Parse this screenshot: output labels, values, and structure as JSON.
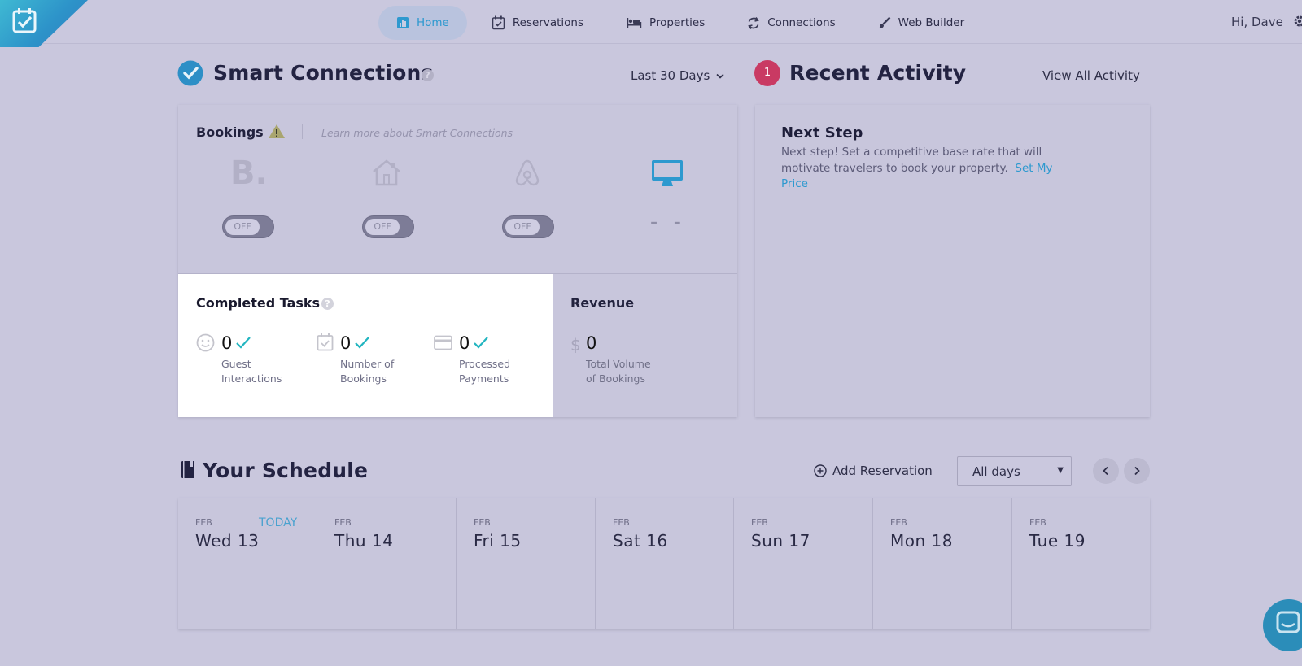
{
  "nav": {
    "items": [
      {
        "label": "Home",
        "icon": "bar-chart-icon",
        "active": true
      },
      {
        "label": "Reservations",
        "icon": "calendar-check-icon",
        "active": false
      },
      {
        "label": "Properties",
        "icon": "bed-icon",
        "active": false
      },
      {
        "label": "Connections",
        "icon": "sync-icon",
        "active": false
      },
      {
        "label": "Web Builder",
        "icon": "brush-icon",
        "active": false
      }
    ],
    "greeting": "Hi, Dave"
  },
  "smart_connections": {
    "title": "Smart Connections",
    "period": "Last 30 Days",
    "bookings": {
      "title": "Bookings",
      "learn_more": "Learn more about Smart Connections",
      "channels": [
        {
          "name": "booking-com",
          "icon": "booking-b-icon",
          "state": "OFF"
        },
        {
          "name": "homeaway",
          "icon": "house-icon",
          "state": "OFF"
        },
        {
          "name": "airbnb",
          "icon": "airbnb-icon",
          "state": "OFF"
        },
        {
          "name": "website",
          "icon": "monitor-icon",
          "state": "- -"
        }
      ]
    },
    "completed_tasks": {
      "title": "Completed Tasks",
      "items": [
        {
          "value": "0",
          "label": "Guest\nInteractions",
          "line1": "Guest",
          "line2": "Interactions"
        },
        {
          "value": "0",
          "label": "Number of Bookings",
          "line1": "Number of",
          "line2": "Bookings"
        },
        {
          "value": "0",
          "label": "Processed Payments",
          "line1": "Processed",
          "line2": "Payments"
        }
      ]
    },
    "revenue": {
      "title": "Revenue",
      "currency": "$",
      "value": "0",
      "line1": "Total Volume",
      "line2": "of Bookings"
    }
  },
  "recent_activity": {
    "badge": "1",
    "title": "Recent Activity",
    "view_all": "View All Activity",
    "next_step": {
      "title": "Next Step",
      "line1": "Next step! Set a competitive base rate that will",
      "line2": "motivate travelers to book your property.",
      "link_part1": "Set My",
      "link_part2": "Price"
    }
  },
  "schedule": {
    "title": "Your Schedule",
    "add_reservation": "Add Reservation",
    "filter_selected": "All days",
    "today_label": "TODAY",
    "days": [
      {
        "month": "FEB",
        "name": "Wed 13",
        "today": true
      },
      {
        "month": "FEB",
        "name": "Thu 14",
        "today": false
      },
      {
        "month": "FEB",
        "name": "Fri 15",
        "today": false
      },
      {
        "month": "FEB",
        "name": "Sat 16",
        "today": false
      },
      {
        "month": "FEB",
        "name": "Sun 17",
        "today": false
      },
      {
        "month": "FEB",
        "name": "Mon 18",
        "today": false
      },
      {
        "month": "FEB",
        "name": "Tue 19",
        "today": false
      }
    ]
  },
  "colors": {
    "accent": "#2d99cf",
    "overlay_bg": "#c9c7dd",
    "badge_red": "#c93a63",
    "check_teal": "#22b5c0"
  }
}
